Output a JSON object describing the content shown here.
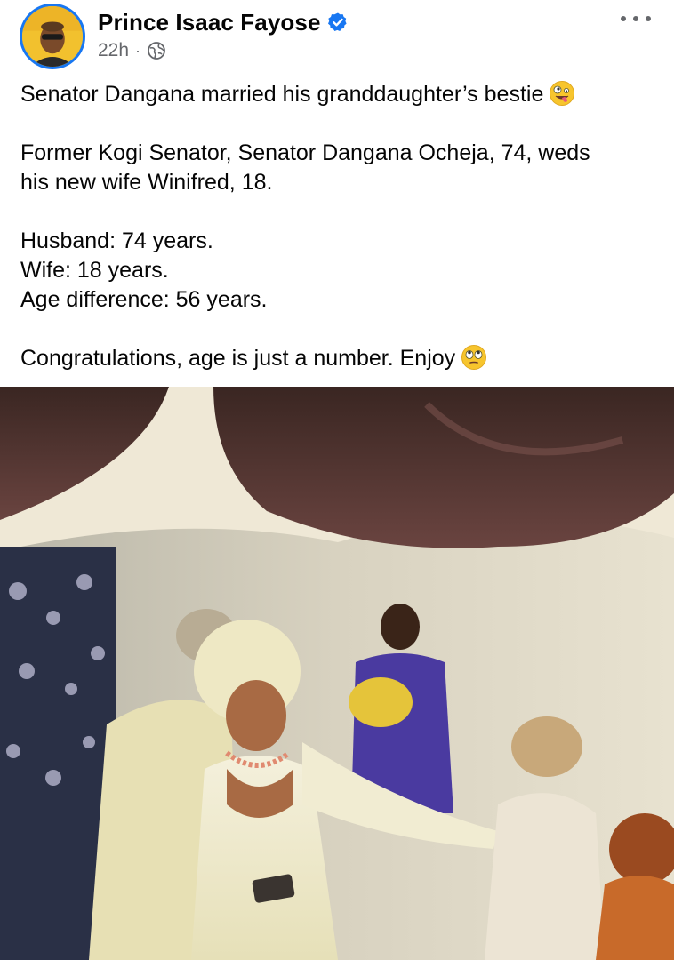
{
  "post": {
    "author": {
      "name": "Prince Isaac Fayose",
      "verified": true,
      "avatar_icon": "profile-photo"
    },
    "meta": {
      "time": "22h",
      "separator": "·",
      "audience_icon": "globe-icon"
    },
    "menu_icon": "more-options-icon",
    "text": {
      "headline": "Senator Dangana married his granddaughter’s bestie",
      "headline_emoji": "zany-face",
      "paragraph2_line1": "Former Kogi Senator, Senator Dangana Ocheja, 74, weds",
      "paragraph2_line2": "his new wife Winifred, 18.",
      "husband": "Husband: 74 years.",
      "wife": "Wife: 18 years.",
      "age_difference": "Age difference: 56 years.",
      "closing": "Congratulations, age is just a number. Enjoy",
      "closing_emoji": "rolling-eyes-face"
    },
    "media": {
      "type": "photo"
    }
  },
  "colors": {
    "verified_badge": "#1877f2",
    "meta_text": "#65676b",
    "body_text": "#050505"
  }
}
